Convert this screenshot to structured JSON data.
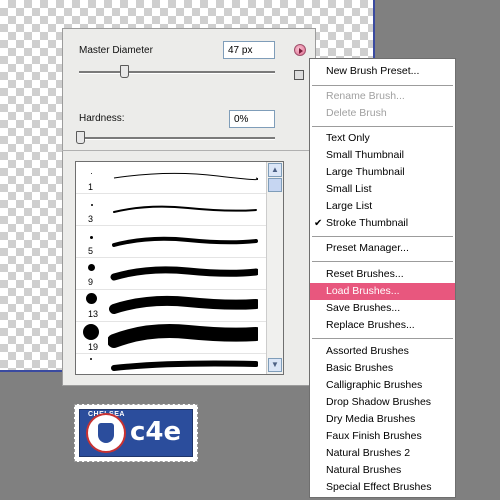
{
  "brush_panel": {
    "master_diameter_label": "Master Diameter",
    "master_diameter_value": "47 px",
    "hardness_label": "Hardness:",
    "hardness_value": "0%",
    "brushes": [
      {
        "size": "1"
      },
      {
        "size": "3"
      },
      {
        "size": "5"
      },
      {
        "size": "9"
      },
      {
        "size": "13"
      },
      {
        "size": "19"
      }
    ]
  },
  "menu": {
    "items": [
      {
        "label": "New Brush Preset...",
        "enabled": true
      },
      {
        "label": "Rename Brush...",
        "enabled": false
      },
      {
        "label": "Delete Brush",
        "enabled": false
      },
      {
        "label": "Text Only",
        "enabled": true
      },
      {
        "label": "Small Thumbnail",
        "enabled": true
      },
      {
        "label": "Large Thumbnail",
        "enabled": true
      },
      {
        "label": "Small List",
        "enabled": true
      },
      {
        "label": "Large List",
        "enabled": true
      },
      {
        "label": "Stroke Thumbnail",
        "enabled": true,
        "checked": true
      },
      {
        "label": "Preset Manager...",
        "enabled": true
      },
      {
        "label": "Reset Brushes...",
        "enabled": true
      },
      {
        "label": "Load Brushes...",
        "enabled": true,
        "highlighted": true
      },
      {
        "label": "Save Brushes...",
        "enabled": true
      },
      {
        "label": "Replace Brushes...",
        "enabled": true
      },
      {
        "label": "Assorted Brushes",
        "enabled": true
      },
      {
        "label": "Basic Brushes",
        "enabled": true
      },
      {
        "label": "Calligraphic Brushes",
        "enabled": true
      },
      {
        "label": "Drop Shadow Brushes",
        "enabled": true
      },
      {
        "label": "Dry Media Brushes",
        "enabled": true
      },
      {
        "label": "Faux Finish Brushes",
        "enabled": true
      },
      {
        "label": "Natural Brushes 2",
        "enabled": true
      },
      {
        "label": "Natural Brushes",
        "enabled": true
      },
      {
        "label": "Special Effect Brushes",
        "enabled": true
      }
    ],
    "highlight_color": "#e8577e"
  },
  "badge": {
    "club_text": "CHELSEA",
    "logo_text": "c4e"
  },
  "icons": {
    "menu_button": "flyout-arrow-icon",
    "new_preset": "new-preset-icon",
    "check": "checkmark-icon"
  }
}
